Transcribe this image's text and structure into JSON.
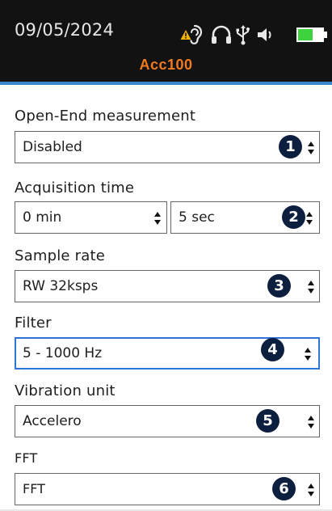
{
  "header": {
    "date": "09/05/2024",
    "title": "Acc100",
    "status_icons": [
      "hearing-warning-icon",
      "headphones-icon",
      "usb-icon",
      "speaker-icon",
      "battery-icon"
    ],
    "title_color": "#f07a1f",
    "accent_line_color": "#3a86c8"
  },
  "form": {
    "open_end": {
      "label": "Open-End measurement",
      "value": "Disabled",
      "badge": "1"
    },
    "acquisition": {
      "label": "Acquisition time",
      "minutes_value": "0 min",
      "seconds_value": "5 sec",
      "badge": "2"
    },
    "sample_rate": {
      "label": "Sample rate",
      "value": "RW 32ksps",
      "badge": "3"
    },
    "filter": {
      "label": "Filter",
      "value": "5 - 1000 Hz",
      "badge": "4"
    },
    "vibration_unit": {
      "label": "Vibration unit",
      "value": "Accelero",
      "badge": "5"
    },
    "fft": {
      "label": "FFT",
      "value": "FFT",
      "badge": "6"
    }
  },
  "colors": {
    "badge_bg": "#0c1f3f",
    "focus_border": "#2e73d9",
    "header_bg": "#121212"
  }
}
